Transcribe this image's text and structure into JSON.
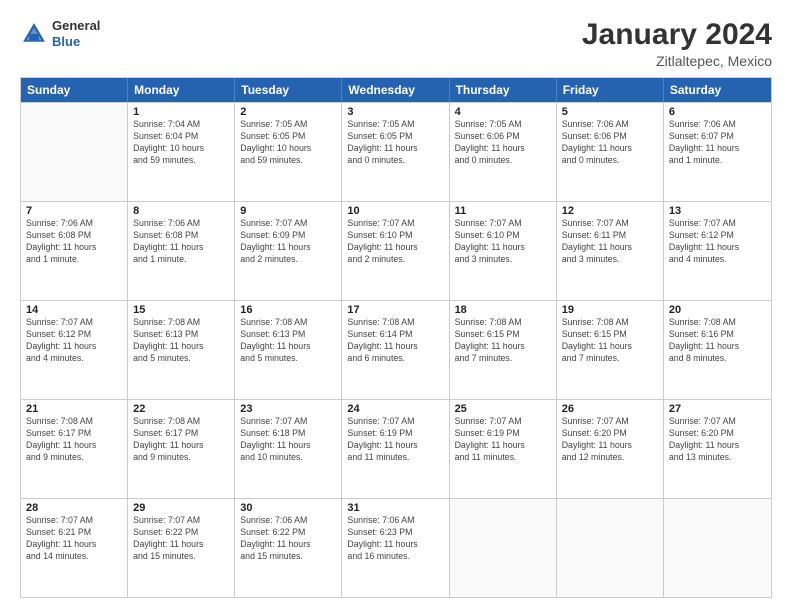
{
  "header": {
    "logo_general": "General",
    "logo_blue": "Blue",
    "main_title": "January 2024",
    "subtitle": "Zitlaltepec, Mexico"
  },
  "calendar": {
    "days_of_week": [
      "Sunday",
      "Monday",
      "Tuesday",
      "Wednesday",
      "Thursday",
      "Friday",
      "Saturday"
    ],
    "weeks": [
      [
        {
          "day": "",
          "info": ""
        },
        {
          "day": "1",
          "info": "Sunrise: 7:04 AM\nSunset: 6:04 PM\nDaylight: 10 hours\nand 59 minutes."
        },
        {
          "day": "2",
          "info": "Sunrise: 7:05 AM\nSunset: 6:05 PM\nDaylight: 10 hours\nand 59 minutes."
        },
        {
          "day": "3",
          "info": "Sunrise: 7:05 AM\nSunset: 6:05 PM\nDaylight: 11 hours\nand 0 minutes."
        },
        {
          "day": "4",
          "info": "Sunrise: 7:05 AM\nSunset: 6:06 PM\nDaylight: 11 hours\nand 0 minutes."
        },
        {
          "day": "5",
          "info": "Sunrise: 7:06 AM\nSunset: 6:06 PM\nDaylight: 11 hours\nand 0 minutes."
        },
        {
          "day": "6",
          "info": "Sunrise: 7:06 AM\nSunset: 6:07 PM\nDaylight: 11 hours\nand 1 minute."
        }
      ],
      [
        {
          "day": "7",
          "info": "Sunrise: 7:06 AM\nSunset: 6:08 PM\nDaylight: 11 hours\nand 1 minute."
        },
        {
          "day": "8",
          "info": "Sunrise: 7:06 AM\nSunset: 6:08 PM\nDaylight: 11 hours\nand 1 minute."
        },
        {
          "day": "9",
          "info": "Sunrise: 7:07 AM\nSunset: 6:09 PM\nDaylight: 11 hours\nand 2 minutes."
        },
        {
          "day": "10",
          "info": "Sunrise: 7:07 AM\nSunset: 6:10 PM\nDaylight: 11 hours\nand 2 minutes."
        },
        {
          "day": "11",
          "info": "Sunrise: 7:07 AM\nSunset: 6:10 PM\nDaylight: 11 hours\nand 3 minutes."
        },
        {
          "day": "12",
          "info": "Sunrise: 7:07 AM\nSunset: 6:11 PM\nDaylight: 11 hours\nand 3 minutes."
        },
        {
          "day": "13",
          "info": "Sunrise: 7:07 AM\nSunset: 6:12 PM\nDaylight: 11 hours\nand 4 minutes."
        }
      ],
      [
        {
          "day": "14",
          "info": "Sunrise: 7:07 AM\nSunset: 6:12 PM\nDaylight: 11 hours\nand 4 minutes."
        },
        {
          "day": "15",
          "info": "Sunrise: 7:08 AM\nSunset: 6:13 PM\nDaylight: 11 hours\nand 5 minutes."
        },
        {
          "day": "16",
          "info": "Sunrise: 7:08 AM\nSunset: 6:13 PM\nDaylight: 11 hours\nand 5 minutes."
        },
        {
          "day": "17",
          "info": "Sunrise: 7:08 AM\nSunset: 6:14 PM\nDaylight: 11 hours\nand 6 minutes."
        },
        {
          "day": "18",
          "info": "Sunrise: 7:08 AM\nSunset: 6:15 PM\nDaylight: 11 hours\nand 7 minutes."
        },
        {
          "day": "19",
          "info": "Sunrise: 7:08 AM\nSunset: 6:15 PM\nDaylight: 11 hours\nand 7 minutes."
        },
        {
          "day": "20",
          "info": "Sunrise: 7:08 AM\nSunset: 6:16 PM\nDaylight: 11 hours\nand 8 minutes."
        }
      ],
      [
        {
          "day": "21",
          "info": "Sunrise: 7:08 AM\nSunset: 6:17 PM\nDaylight: 11 hours\nand 9 minutes."
        },
        {
          "day": "22",
          "info": "Sunrise: 7:08 AM\nSunset: 6:17 PM\nDaylight: 11 hours\nand 9 minutes."
        },
        {
          "day": "23",
          "info": "Sunrise: 7:07 AM\nSunset: 6:18 PM\nDaylight: 11 hours\nand 10 minutes."
        },
        {
          "day": "24",
          "info": "Sunrise: 7:07 AM\nSunset: 6:19 PM\nDaylight: 11 hours\nand 11 minutes."
        },
        {
          "day": "25",
          "info": "Sunrise: 7:07 AM\nSunset: 6:19 PM\nDaylight: 11 hours\nand 11 minutes."
        },
        {
          "day": "26",
          "info": "Sunrise: 7:07 AM\nSunset: 6:20 PM\nDaylight: 11 hours\nand 12 minutes."
        },
        {
          "day": "27",
          "info": "Sunrise: 7:07 AM\nSunset: 6:20 PM\nDaylight: 11 hours\nand 13 minutes."
        }
      ],
      [
        {
          "day": "28",
          "info": "Sunrise: 7:07 AM\nSunset: 6:21 PM\nDaylight: 11 hours\nand 14 minutes."
        },
        {
          "day": "29",
          "info": "Sunrise: 7:07 AM\nSunset: 6:22 PM\nDaylight: 11 hours\nand 15 minutes."
        },
        {
          "day": "30",
          "info": "Sunrise: 7:06 AM\nSunset: 6:22 PM\nDaylight: 11 hours\nand 15 minutes."
        },
        {
          "day": "31",
          "info": "Sunrise: 7:06 AM\nSunset: 6:23 PM\nDaylight: 11 hours\nand 16 minutes."
        },
        {
          "day": "",
          "info": ""
        },
        {
          "day": "",
          "info": ""
        },
        {
          "day": "",
          "info": ""
        }
      ]
    ]
  }
}
